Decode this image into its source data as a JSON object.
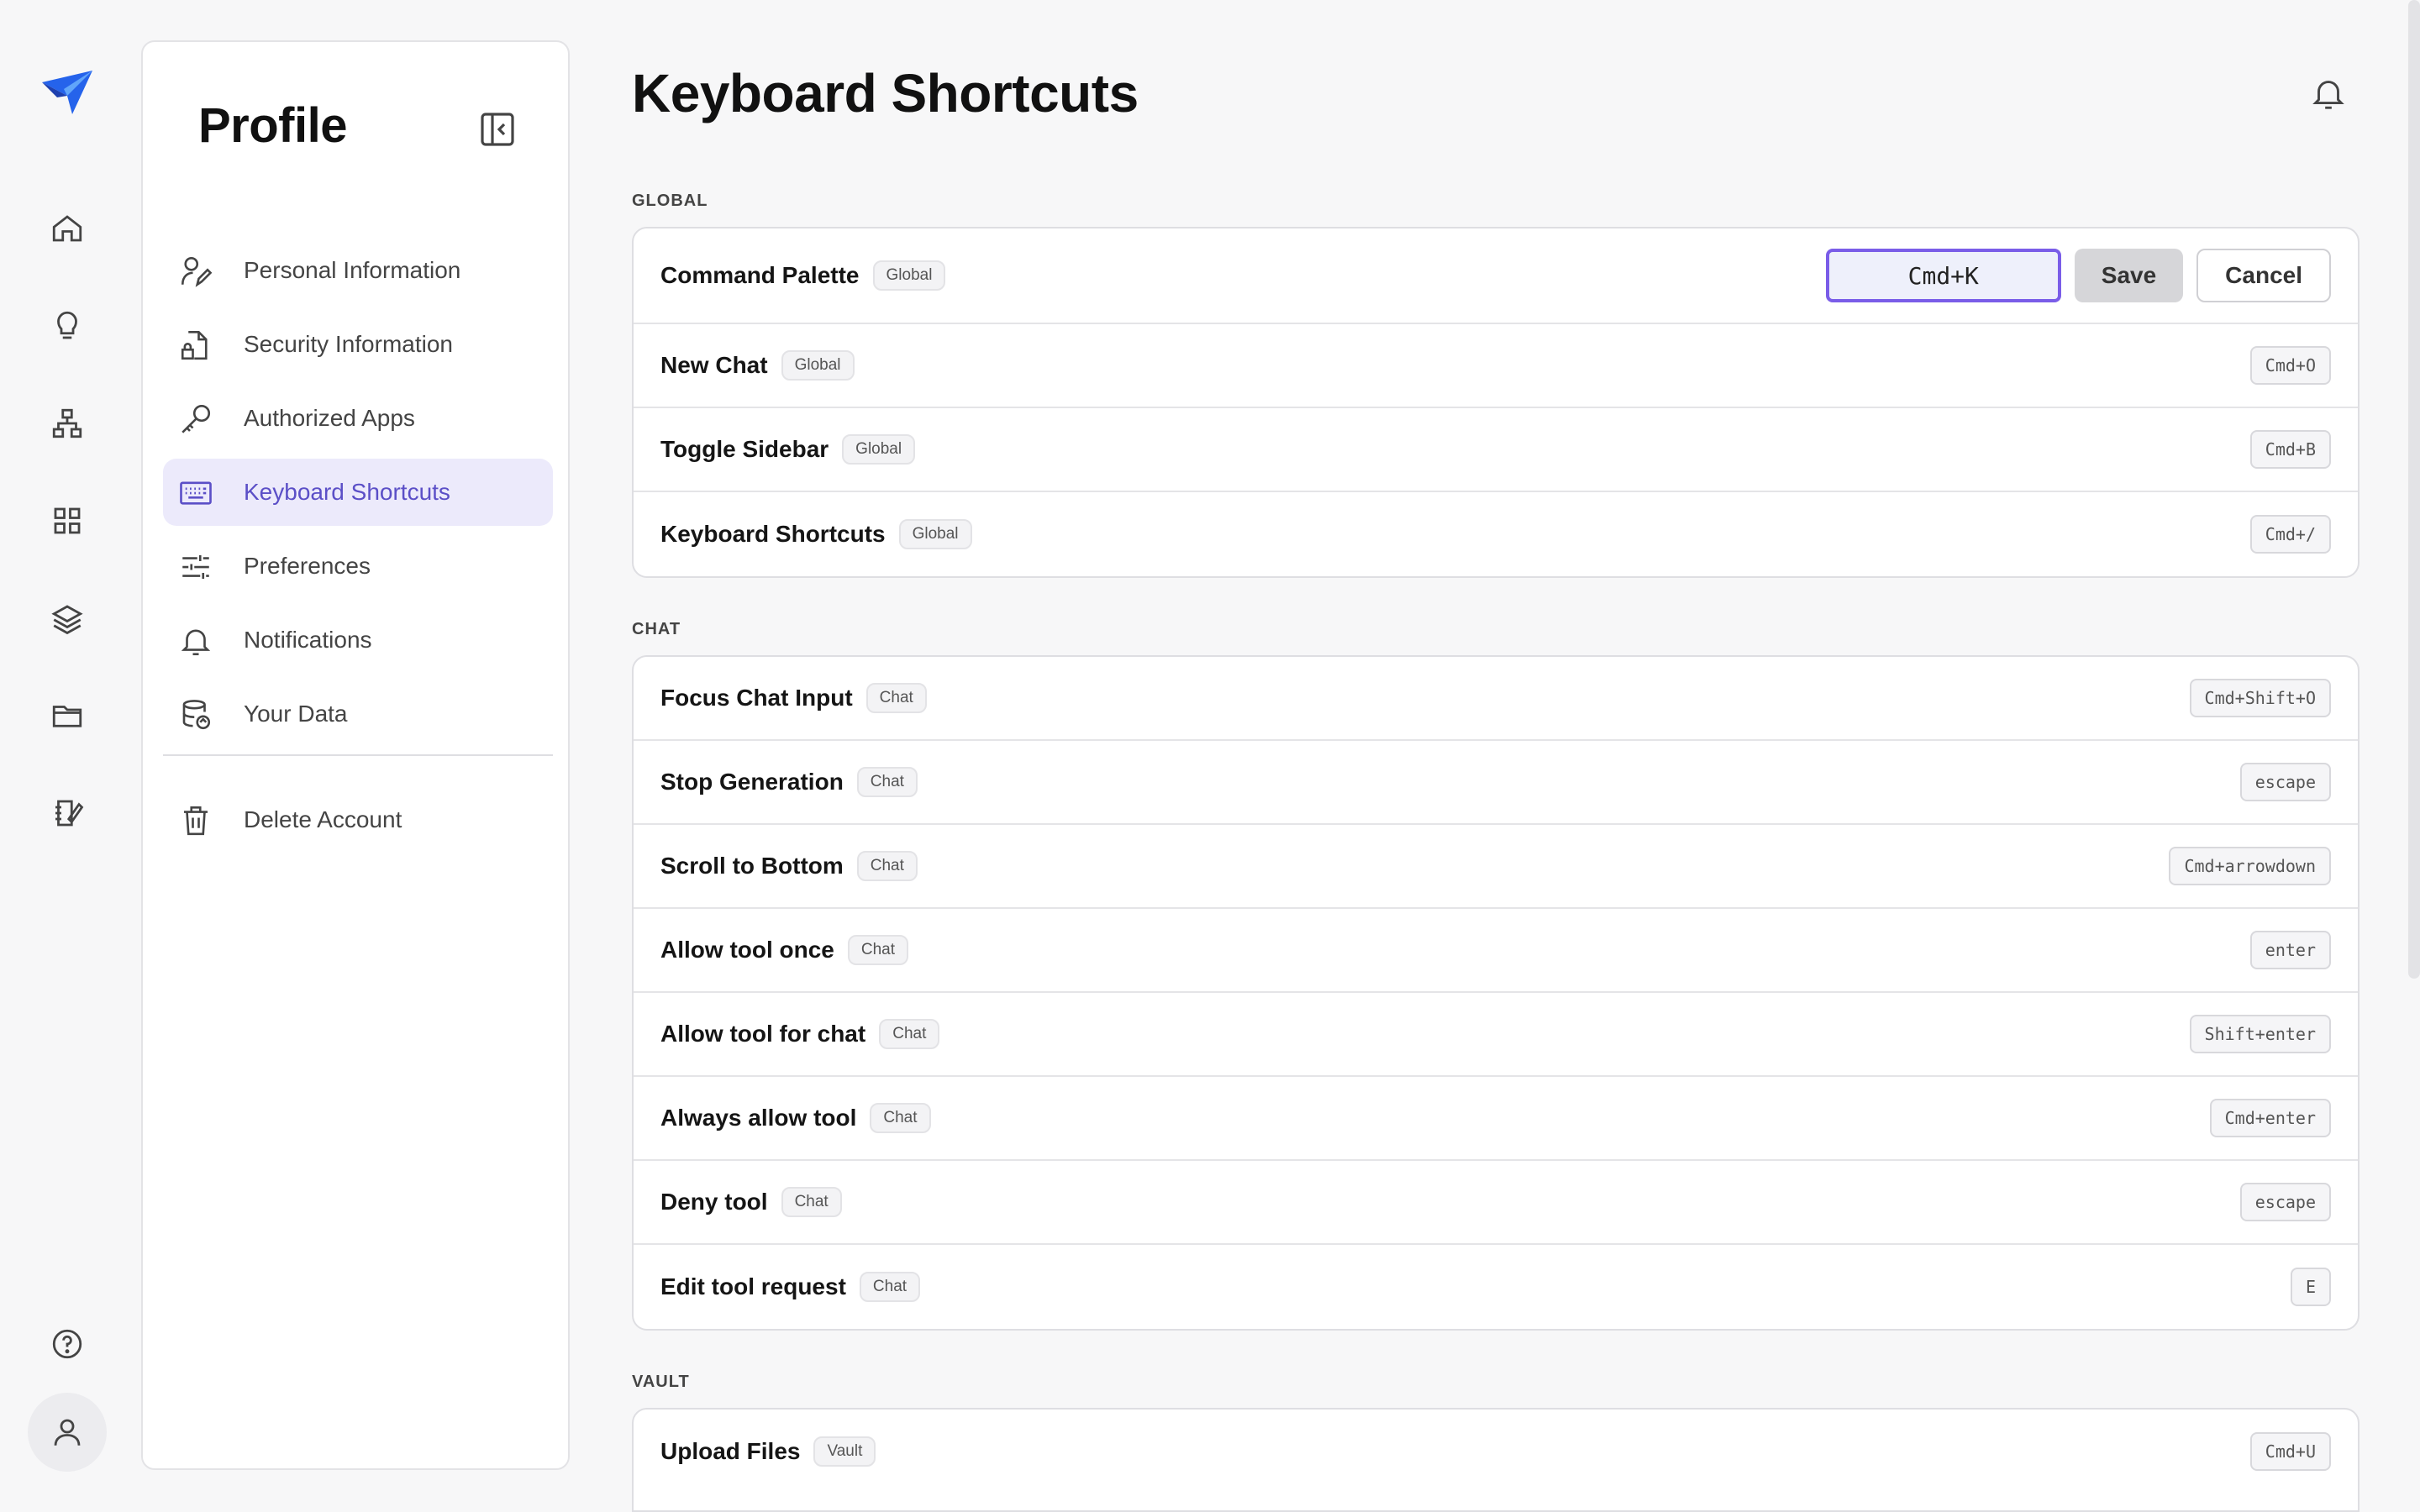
{
  "colors": {
    "accent": "#5b4fc7",
    "active_bg": "#eceafb",
    "logo_blue": "#2563eb"
  },
  "rail": {
    "items": [
      {
        "icon": "home-icon"
      },
      {
        "icon": "lightbulb-icon"
      },
      {
        "icon": "org-chart-icon"
      },
      {
        "icon": "grid-icon"
      },
      {
        "icon": "layers-icon"
      },
      {
        "icon": "folder-icon"
      },
      {
        "icon": "notebook-edit-icon"
      }
    ],
    "bottom": [
      {
        "icon": "help-icon"
      },
      {
        "icon": "user-icon"
      }
    ]
  },
  "profile": {
    "title": "Profile",
    "menu": [
      {
        "label": "Personal Information",
        "icon": "user-edit-icon"
      },
      {
        "label": "Security Information",
        "icon": "document-lock-icon"
      },
      {
        "label": "Authorized Apps",
        "icon": "key-icon"
      },
      {
        "label": "Keyboard Shortcuts",
        "icon": "keyboard-icon",
        "active": true
      },
      {
        "label": "Preferences",
        "icon": "sliders-icon"
      },
      {
        "label": "Notifications",
        "icon": "bell-icon"
      },
      {
        "label": "Your Data",
        "icon": "database-icon"
      }
    ],
    "danger": {
      "label": "Delete Account",
      "icon": "trash-icon"
    }
  },
  "main": {
    "title": "Keyboard Shortcuts",
    "sections": [
      {
        "label": "GLOBAL",
        "rows": [
          {
            "name": "Command Palette",
            "tag": "Global",
            "editing": true,
            "input_value": "Cmd+K",
            "save_label": "Save",
            "cancel_label": "Cancel"
          },
          {
            "name": "New Chat",
            "tag": "Global",
            "key": "Cmd+O"
          },
          {
            "name": "Toggle Sidebar",
            "tag": "Global",
            "key": "Cmd+B"
          },
          {
            "name": "Keyboard Shortcuts",
            "tag": "Global",
            "key": "Cmd+/"
          }
        ]
      },
      {
        "label": "CHAT",
        "rows": [
          {
            "name": "Focus Chat Input",
            "tag": "Chat",
            "key": "Cmd+Shift+O"
          },
          {
            "name": "Stop Generation",
            "tag": "Chat",
            "key": "escape"
          },
          {
            "name": "Scroll to Bottom",
            "tag": "Chat",
            "key": "Cmd+arrowdown"
          },
          {
            "name": "Allow tool once",
            "tag": "Chat",
            "key": "enter"
          },
          {
            "name": "Allow tool for chat",
            "tag": "Chat",
            "key": "Shift+enter"
          },
          {
            "name": "Always allow tool",
            "tag": "Chat",
            "key": "Cmd+enter"
          },
          {
            "name": "Deny tool",
            "tag": "Chat",
            "key": "escape"
          },
          {
            "name": "Edit tool request",
            "tag": "Chat",
            "key": "E"
          }
        ]
      },
      {
        "label": "VAULT",
        "rows": [
          {
            "name": "Upload Files",
            "tag": "Vault",
            "key": "Cmd+U"
          }
        ]
      }
    ]
  }
}
